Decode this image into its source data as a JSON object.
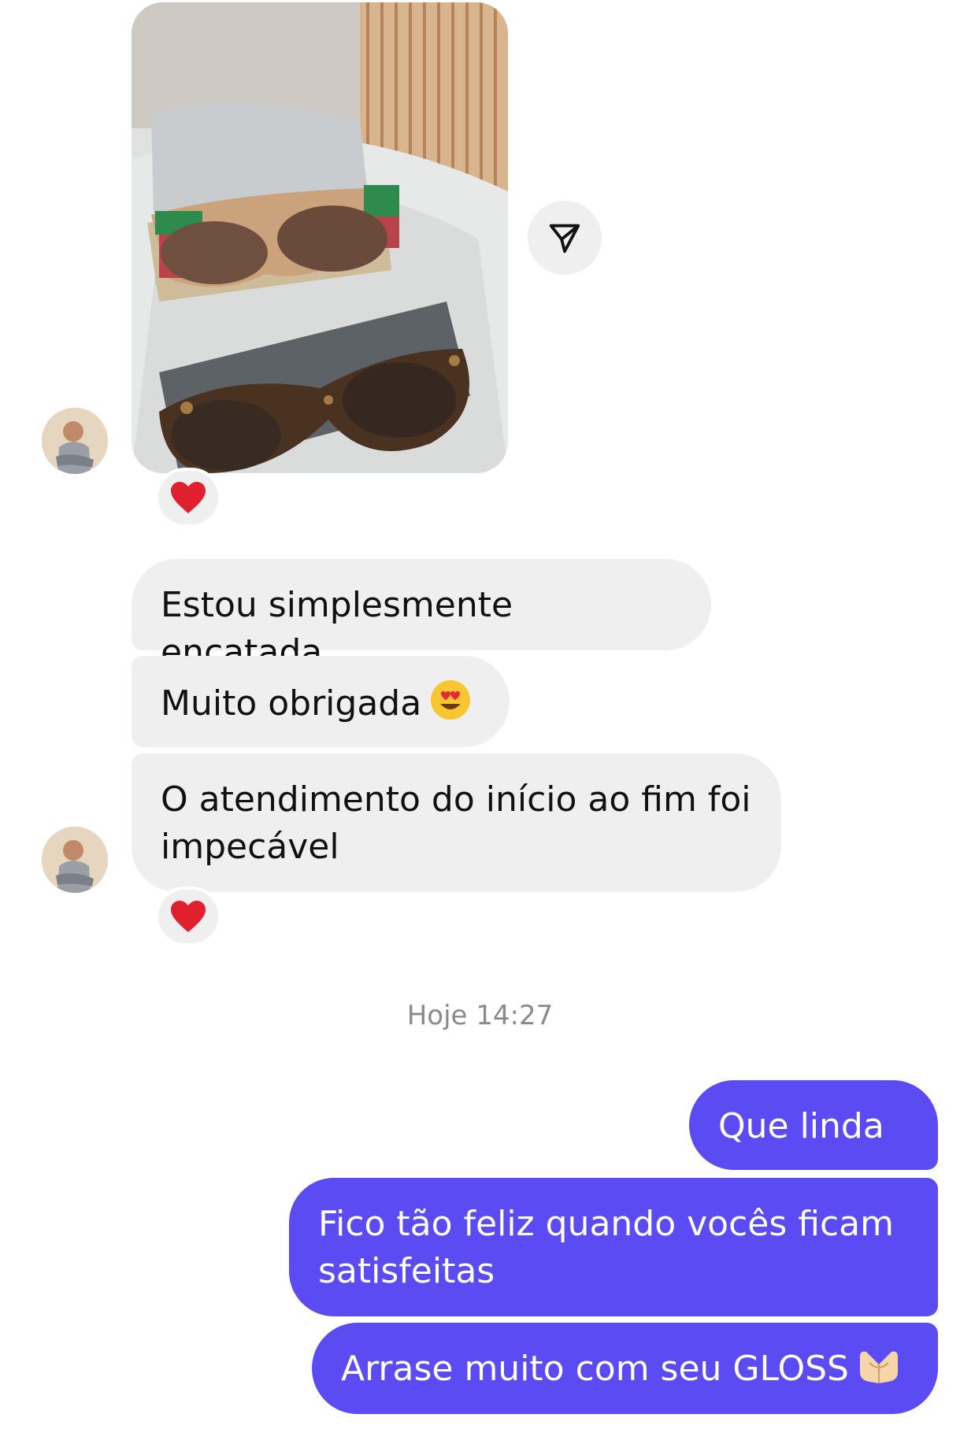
{
  "conversation": {
    "incoming": [
      {
        "text": "Estou simplesmente encatada"
      },
      {
        "text": "Muito obrigada"
      },
      {
        "text": "O atendimento do início ao fim foi impecável"
      }
    ],
    "timestamp": "Hoje 14:27",
    "outgoing": [
      {
        "text": "Que linda .."
      },
      {
        "text": "Fico tão feliz quando vocês ficam satisfeitas"
      },
      {
        "text": "Arrase muito com seu GLOSS"
      }
    ]
  },
  "reactions": {
    "emoji": "heart",
    "color": "#e0202e"
  },
  "icons": {
    "share": "paper-plane-icon",
    "heart": "heart-icon",
    "heart_eyes": "heart-eyes-emoji-icon",
    "heart_hands": "heart-hands-emoji-icon"
  },
  "colors": {
    "outgoing_bubble": "#5b4bf2",
    "incoming_bubble": "#efefef",
    "timestamp": "#8a8a8a"
  }
}
